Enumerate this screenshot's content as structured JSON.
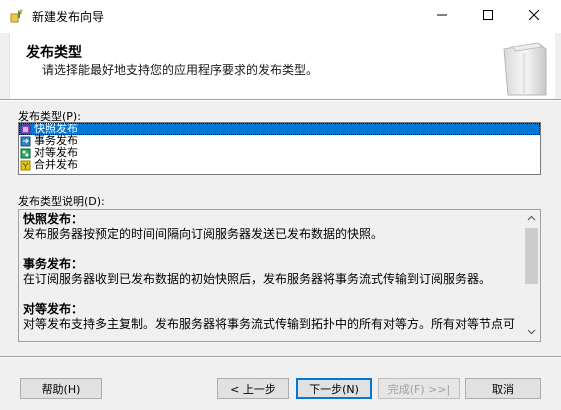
{
  "window": {
    "title": "新建发布向导"
  },
  "header": {
    "title": "发布类型",
    "description": "请选择能最好地支持您的应用程序要求的发布类型。"
  },
  "type_list": {
    "label": "发布类型(P):",
    "items": [
      {
        "label": "快照发布",
        "icon": "snapshot-publication-icon",
        "selected": true
      },
      {
        "label": "事务发布",
        "icon": "transactional-publication-icon",
        "selected": false
      },
      {
        "label": "对等发布",
        "icon": "peer-to-peer-publication-icon",
        "selected": false
      },
      {
        "label": "合并发布",
        "icon": "merge-publication-icon",
        "selected": false
      }
    ]
  },
  "description": {
    "label": "发布类型说明(D):",
    "sections": [
      {
        "heading": "快照发布：",
        "text": "发布服务器按预定的时间间隔向订阅服务器发送已发布数据的快照。"
      },
      {
        "heading": "事务发布：",
        "text": "在订阅服务器收到已发布数据的初始快照后，发布服务器将事务流式传输到订阅服务器。"
      },
      {
        "heading": "对等发布：",
        "text": "对等发布支持多主复制。发布服务器将事务流式传输到拓扑中的所有对等方。所有对等节点可"
      }
    ]
  },
  "buttons": {
    "help": "帮助(H)",
    "back": "< 上一步",
    "next": "下一步(N)",
    "finish": "完成(F) >>|",
    "cancel": "取消"
  },
  "colors": {
    "selection": "#0078d7",
    "window_bg": "#f0f0f0"
  }
}
